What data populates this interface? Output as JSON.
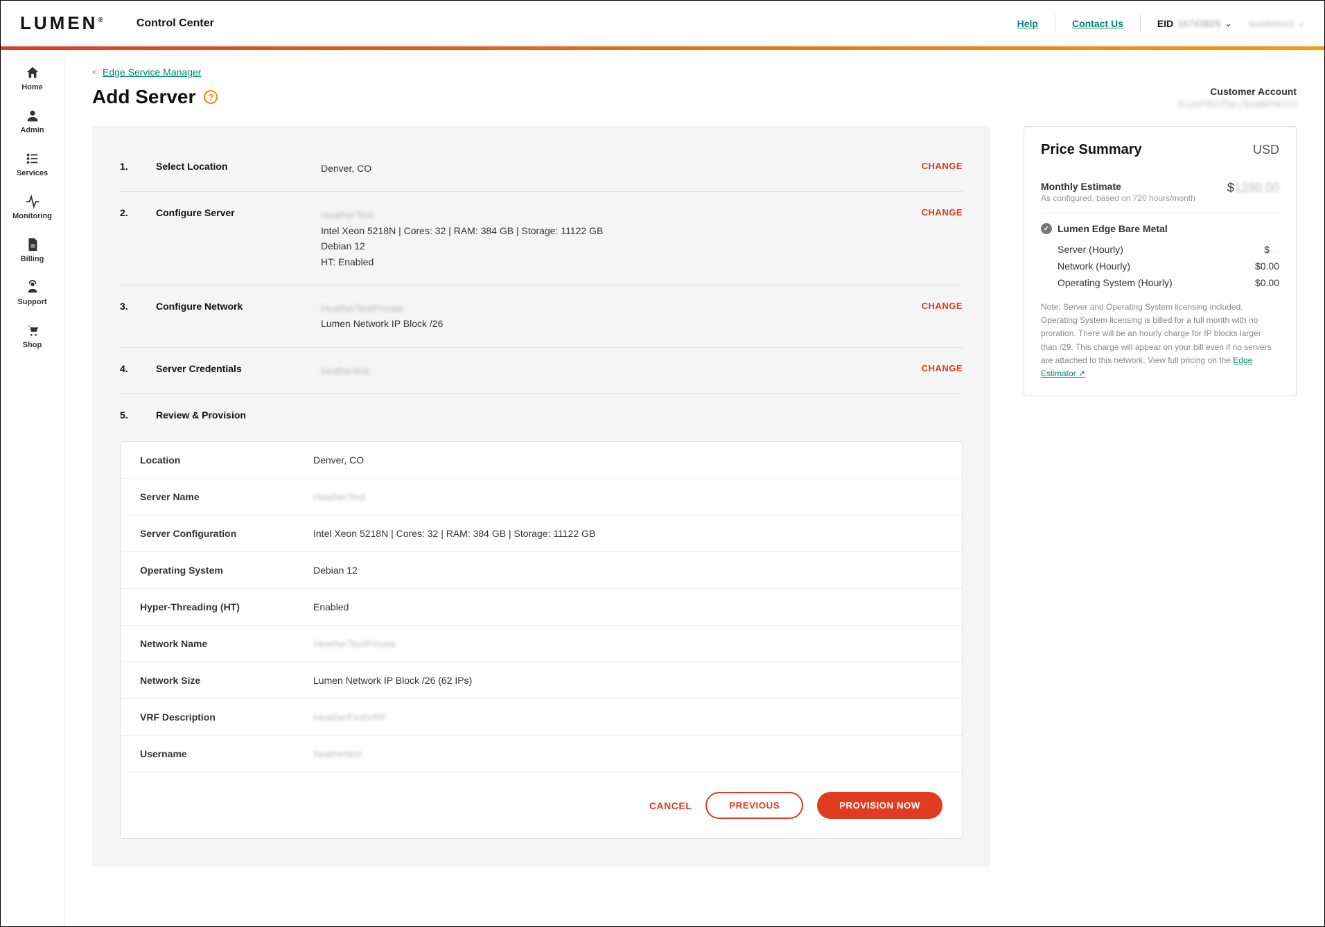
{
  "header": {
    "logo": "LUMEN",
    "app_title": "Control Center",
    "help": "Help",
    "contact": "Contact Us",
    "eid_label": "EID",
    "eid_value": "16743825",
    "user_value": "testdemo3"
  },
  "sidebar": [
    {
      "label": "Home"
    },
    {
      "label": "Admin"
    },
    {
      "label": "Services"
    },
    {
      "label": "Monitoring"
    },
    {
      "label": "Billing"
    },
    {
      "label": "Support"
    },
    {
      "label": "Shop"
    }
  ],
  "breadcrumb": {
    "back": "Edge Service Manager"
  },
  "page": {
    "title": "Add Server",
    "cust_label": "Customer Account",
    "cust_value": "5-LWP8C754 (TestBPNCC)"
  },
  "steps": {
    "change": "CHANGE",
    "s1_num": "1.",
    "s1_label": "Select Location",
    "s1_value": "Denver, CO",
    "s2_num": "2.",
    "s2_label": "Configure Server",
    "s2_name": "HeatherTest",
    "s2_l1": "Intel Xeon 5218N | Cores: 32 | RAM: 384 GB | Storage: 11122 GB",
    "s2_l2": "Debian 12",
    "s2_l3": "HT: Enabled",
    "s3_num": "3.",
    "s3_label": "Configure Network",
    "s3_name": "HeatherTestPrivate",
    "s3_l1": "Lumen Network IP Block /26",
    "s4_num": "4.",
    "s4_label": "Server Credentials",
    "s4_name": "heathertest",
    "s5_num": "5.",
    "s5_label": "Review & Provision"
  },
  "review": {
    "rows": [
      {
        "k": "Location",
        "v": "Denver, CO"
      },
      {
        "k": "Server Name",
        "v": "HeatherTest",
        "blur": true
      },
      {
        "k": "Server Configuration",
        "v": "Intel Xeon 5218N | Cores: 32 | RAM: 384 GB | Storage: 11122 GB"
      },
      {
        "k": "Operating System",
        "v": "Debian 12"
      },
      {
        "k": "Hyper-Threading (HT)",
        "v": "Enabled"
      },
      {
        "k": "Network Name",
        "v": "HeatherTestPrivate",
        "blur": true
      },
      {
        "k": "Network Size",
        "v": "Lumen Network IP Block /26 (62 IPs)"
      },
      {
        "k": "VRF Description",
        "v": "HeatherFirstVRF",
        "blur": true
      },
      {
        "k": "Username",
        "v": "heathertest",
        "blur": true
      }
    ]
  },
  "actions": {
    "cancel": "CANCEL",
    "previous": "PREVIOUS",
    "provision": "PROVISION NOW"
  },
  "summary": {
    "title": "Price Summary",
    "currency": "USD",
    "est_label": "Monthly Estimate",
    "est_sub": "As configured, based on 720 hours/month",
    "est_val_prefix": "$",
    "est_val": "1280.00",
    "product": "Lumen Edge Bare Metal",
    "items": [
      {
        "k": "Server (Hourly)",
        "v_prefix": "$",
        "v": "…",
        "blur": true
      },
      {
        "k": "Network (Hourly)",
        "v": "$0.00"
      },
      {
        "k": "Operating System (Hourly)",
        "v": "$0.00"
      }
    ],
    "note_prefix": "Note: Server and Operating System licensing included. Operating System licensing is billed for a full month with no proration. There will be an hourly charge for IP blocks larger than /29. This charge will appear on your bill even if no servers are attached to this network. View full pricing on the ",
    "note_link": "Edge Estimator"
  }
}
